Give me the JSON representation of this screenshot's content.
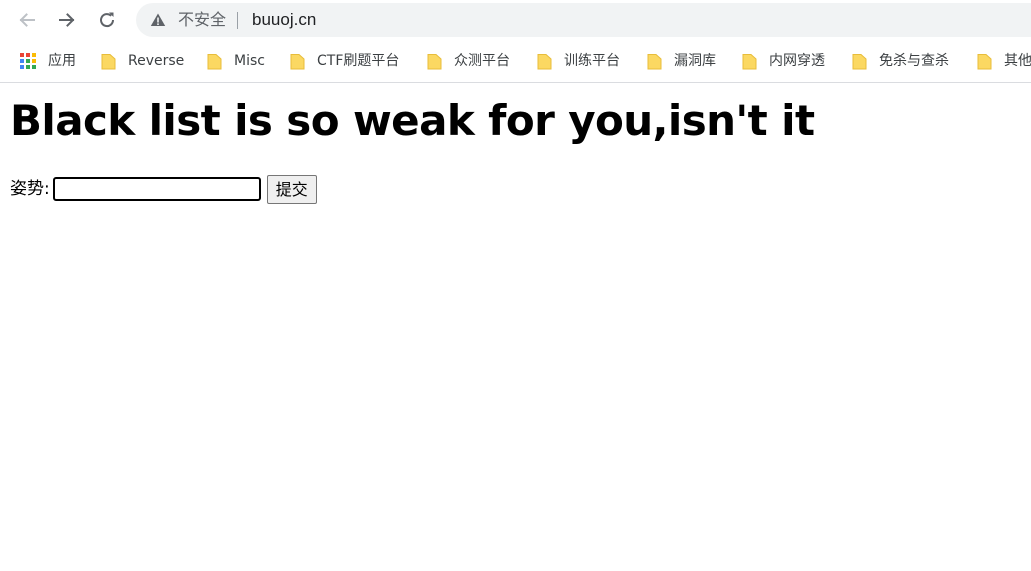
{
  "browser": {
    "security_label": "不安全",
    "url": "buuoj.cn",
    "bookmarks": [
      {
        "label": "应用",
        "icon": "apps-grid-icon"
      },
      {
        "label": "Reverse",
        "icon": "folder-icon"
      },
      {
        "label": "Misc",
        "icon": "folder-icon"
      },
      {
        "label": "CTF刷题平台",
        "icon": "folder-icon"
      },
      {
        "label": "众测平台",
        "icon": "folder-icon"
      },
      {
        "label": "训练平台",
        "icon": "folder-icon"
      },
      {
        "label": "漏洞库",
        "icon": "folder-icon"
      },
      {
        "label": "内网穿透",
        "icon": "folder-icon"
      },
      {
        "label": "免杀与查杀",
        "icon": "folder-icon"
      },
      {
        "label": "其他",
        "icon": "folder-icon"
      }
    ]
  },
  "page": {
    "title": "Black list is so weak for you,isn't it",
    "form": {
      "label": "姿势:",
      "input_value": "",
      "submit_label": "提交"
    }
  },
  "colors": {
    "folder": "#fbd862",
    "omnibox_bg": "#f1f3f4",
    "text_muted": "#5f6368"
  }
}
